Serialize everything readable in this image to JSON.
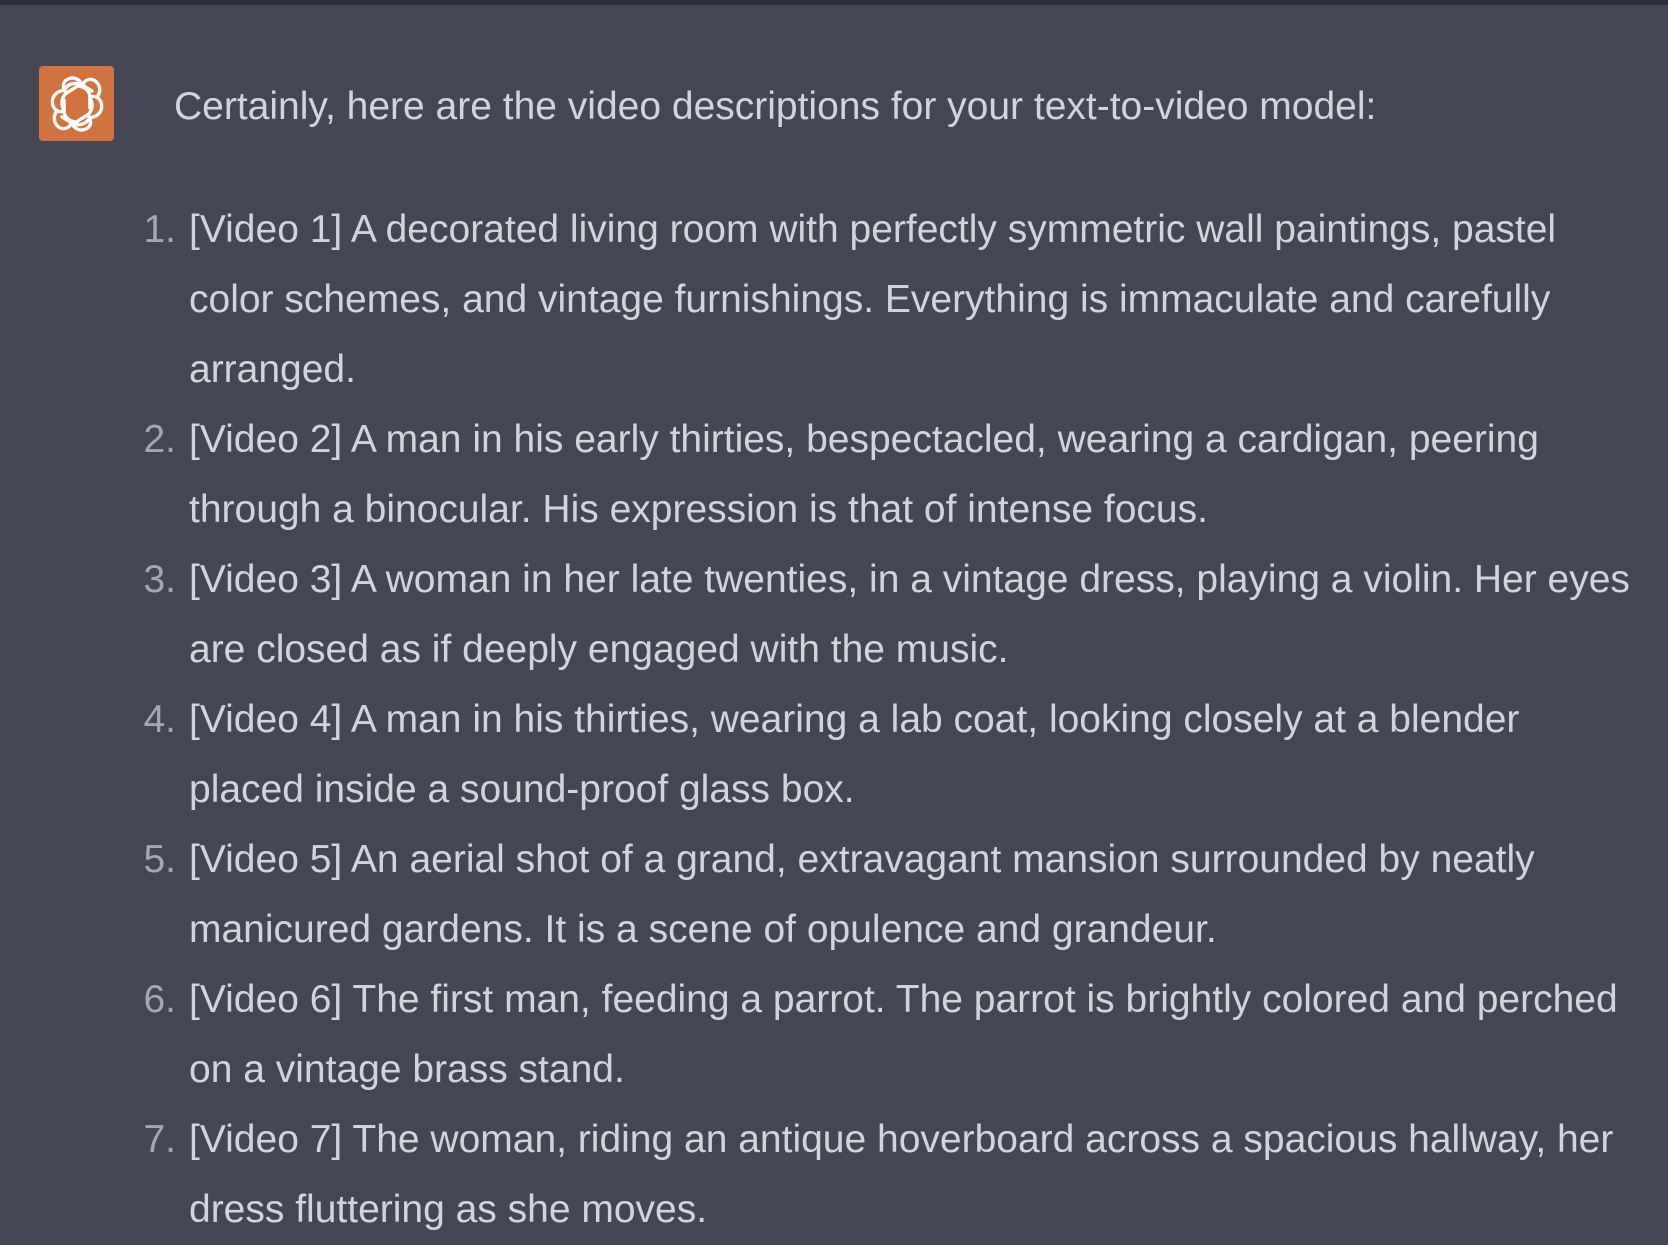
{
  "colors": {
    "background": "#444654",
    "text": "#d1d5db",
    "avatar": "#d0733f",
    "top_border": "#2f3038"
  },
  "assistant": {
    "avatar_icon": "openai-logo-icon"
  },
  "message": {
    "intro": "Certainly, here are the video descriptions for your text-to-video model:",
    "items": [
      {
        "number": "1.",
        "text": "[Video 1] A decorated living room with perfectly symmetric wall paintings, pastel color schemes, and vintage furnishings. Everything is immaculate and carefully arranged."
      },
      {
        "number": "2.",
        "text": "[Video 2] A man in his early thirties, bespectacled, wearing a cardigan, peering through a binocular. His expression is that of intense focus."
      },
      {
        "number": "3.",
        "text": "[Video 3] A woman in her late twenties, in a vintage dress, playing a violin. Her eyes are closed as if deeply engaged with the music."
      },
      {
        "number": "4.",
        "text": "[Video 4] A man in his thirties, wearing a lab coat, looking closely at a blender placed inside a sound-proof glass box."
      },
      {
        "number": "5.",
        "text": "[Video 5] An aerial shot of a grand, extravagant mansion surrounded by neatly manicured gardens. It is a scene of opulence and grandeur."
      },
      {
        "number": "6.",
        "text": "[Video 6] The first man, feeding a parrot. The parrot is brightly colored and perched on a vintage brass stand."
      },
      {
        "number": "7.",
        "text": "[Video 7] The woman, riding an antique hoverboard across a spacious hallway, her dress fluttering as she moves."
      }
    ]
  }
}
